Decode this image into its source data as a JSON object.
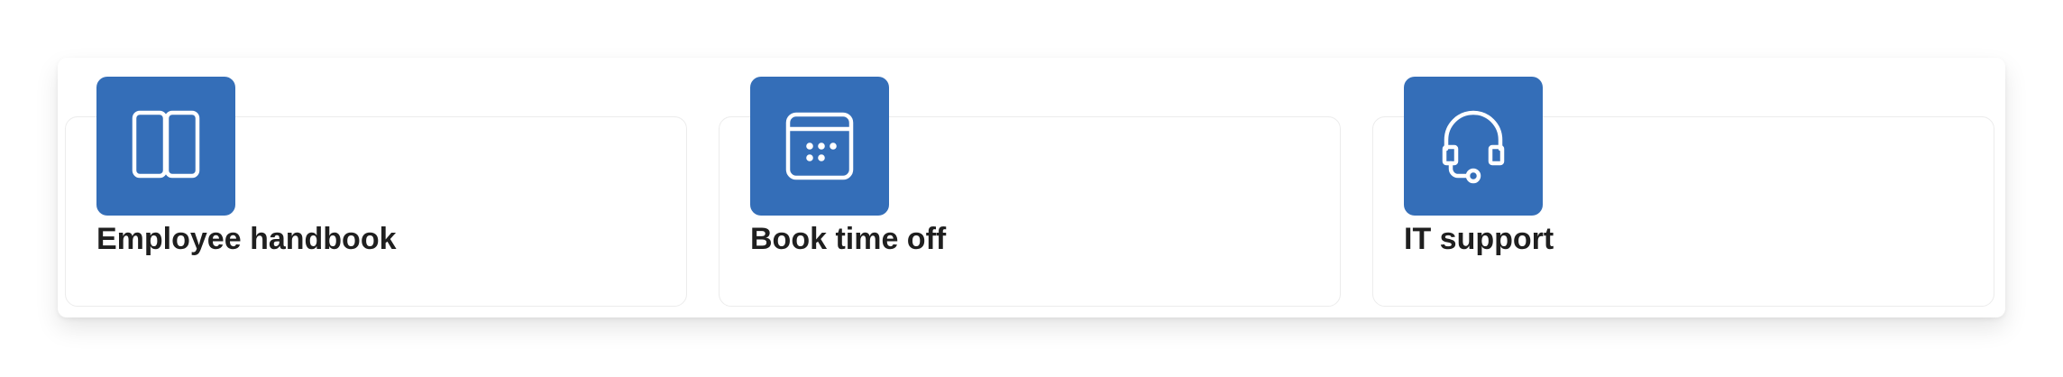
{
  "cards": [
    {
      "title": "Employee handbook",
      "icon": "book-open-icon"
    },
    {
      "title": "Book time off",
      "icon": "calendar-icon"
    },
    {
      "title": "IT support",
      "icon": "headset-icon"
    }
  ],
  "colors": {
    "accent": "#346eb8",
    "title_text": "#1f1f1f",
    "card_border": "#ececec"
  }
}
